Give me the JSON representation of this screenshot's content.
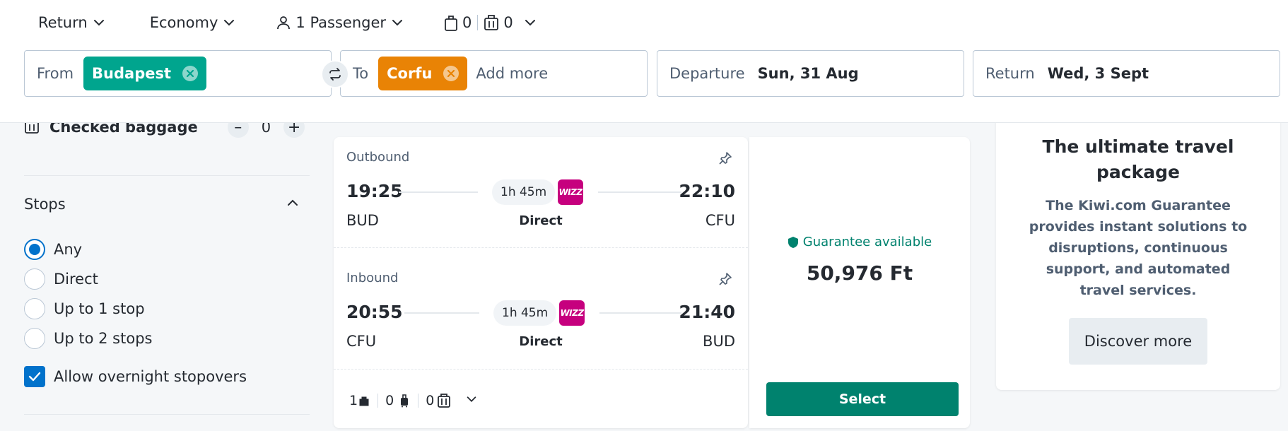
{
  "header": {
    "trip_type": "Return",
    "cabin_class": "Economy",
    "passengers": "1 Passenger",
    "cabin_bags": "0",
    "checked_bags": "0",
    "from_label": "From",
    "from_chip": "Budapest",
    "to_label": "To",
    "to_chip": "Corfu",
    "add_more": "Add more",
    "departure_label": "Departure",
    "departure_value": "Sun, 31 Aug",
    "return_label": "Return",
    "return_value": "Wed, 3 Sept"
  },
  "sidebar": {
    "checked_baggage_label": "Checked baggage",
    "checked_baggage_value": "0",
    "stops_title": "Stops",
    "stop_options": [
      {
        "label": "Any",
        "selected": true
      },
      {
        "label": "Direct",
        "selected": false
      },
      {
        "label": "Up to 1 stop",
        "selected": false
      },
      {
        "label": "Up to 2 stops",
        "selected": false
      }
    ],
    "overnight_label": "Allow overnight stopovers",
    "overnight_checked": true
  },
  "result": {
    "outbound": {
      "label": "Outbound",
      "depart_time": "19:25",
      "arrive_time": "22:10",
      "duration": "1h 45m",
      "from_code": "BUD",
      "to_code": "CFU",
      "stops": "Direct",
      "airline_logo": "WIZZ"
    },
    "inbound": {
      "label": "Inbound",
      "depart_time": "20:55",
      "arrive_time": "21:40",
      "duration": "1h 45m",
      "from_code": "CFU",
      "to_code": "BUD",
      "stops": "Direct",
      "airline_logo": "WIZZ"
    },
    "bags": {
      "personal": "1",
      "cabin": "0",
      "checked": "0"
    },
    "guarantee": "Guarantee available",
    "price": "50,976 Ft",
    "select_label": "Select"
  },
  "promo": {
    "title": "The ultimate travel package",
    "body": "The Kiwi.com Guarantee provides instant solutions to disruptions, continuous support, and automated travel services.",
    "button": "Discover more"
  },
  "colors": {
    "primary_green": "#00826e",
    "chip_green": "#00a58e",
    "chip_orange": "#e98305",
    "radio_blue": "#0172cb",
    "wizz_magenta": "#c6007e"
  }
}
